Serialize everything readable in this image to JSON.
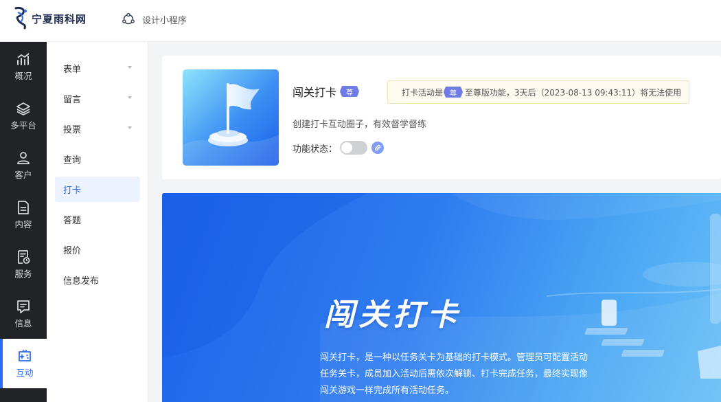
{
  "header": {
    "brand": "宁夏雨科网",
    "design_link": "设计小程序"
  },
  "rail": [
    {
      "label": "概况",
      "icon": "chart-trend-icon"
    },
    {
      "label": "多平台",
      "icon": "layers-icon"
    },
    {
      "label": "客户",
      "icon": "user-icon"
    },
    {
      "label": "内容",
      "icon": "document-icon"
    },
    {
      "label": "服务",
      "icon": "service-doc-icon"
    },
    {
      "label": "信息",
      "icon": "message-icon"
    },
    {
      "label": "互动",
      "icon": "gamepad-icon",
      "active": true
    }
  ],
  "submenu": [
    {
      "label": "表单",
      "has_caret": true
    },
    {
      "label": "留言",
      "has_caret": true
    },
    {
      "label": "投票",
      "has_caret": true
    },
    {
      "label": "查询"
    },
    {
      "label": "打卡",
      "active": true
    },
    {
      "label": "答题"
    },
    {
      "label": "报价"
    },
    {
      "label": "信息发布"
    }
  ],
  "card": {
    "title": "闯关打卡",
    "badge": "尊",
    "notice_prefix": "打卡活动是",
    "notice_badge": "尊",
    "notice_suffix": "至尊版功能，3天后（2023-08-13 09:43:11）将无法使用",
    "description": "创建打卡互动圈子，有效督学督练",
    "status_label": "功能状态：",
    "status_on": false
  },
  "banner": {
    "title": "闯关打卡",
    "description": "闯关打卡，是一种以任务关卡为基础的打卡模式。管理员可配置活动任务关卡，成员加入活动后需依次解锁、打卡完成任务，最终实现像闯关游戏一样完成所有活动任务。"
  },
  "colors": {
    "accent": "#2c6cf6",
    "rail_bg": "#222327",
    "badge": "#6f7ce6",
    "notice_bg": "#fffbf0"
  }
}
